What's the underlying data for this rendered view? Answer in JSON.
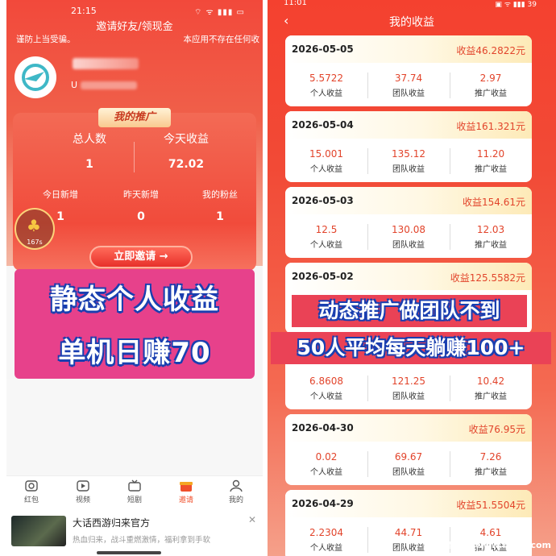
{
  "left": {
    "status_time": "21:15",
    "status_icons": "⌔ ᯤ ▮▮▮ ▭",
    "title": "邀请好友/领现金",
    "notice_left": "谨防上当受骗。",
    "notice_right": "本应用不存在任何收",
    "uid_prefix": "U",
    "promo": {
      "badge": "我的推广",
      "total_people_label": "总人数",
      "total_people_value": "1",
      "today_income_label": "今天收益",
      "today_income_value": "72.02",
      "today_new_label": "今日新增",
      "today_new_value": "1",
      "yesterday_new_label": "昨天新增",
      "yesterday_new_value": "0",
      "fans_label": "我的粉丝",
      "fans_value": "1",
      "invite_button": "立即邀请 →",
      "float_count": "167s"
    },
    "banner_lines": [
      "静态个人收益",
      "单机日赚70"
    ],
    "tabs": [
      {
        "label": "红包",
        "icon": "camera-icon"
      },
      {
        "label": "视频",
        "icon": "play-icon"
      },
      {
        "label": "短剧",
        "icon": "tv-icon"
      },
      {
        "label": "邀请",
        "icon": "gift-icon",
        "active": true
      },
      {
        "label": "我的",
        "icon": "user-icon"
      }
    ],
    "ad": {
      "title": "大话西游归来官方",
      "desc": "热血归来，战斗重燃激情，福利拿到手软",
      "close": "✕"
    },
    "accent_color": "#f04f2b"
  },
  "right": {
    "status_time": "11:01",
    "status_icons": "▣ ᯤ ▮▮▮ 39",
    "back": "‹",
    "title": "我的收益",
    "col_labels": [
      "个人收益",
      "团队收益",
      "推广收益"
    ],
    "cards": [
      {
        "date": "2026-05-05",
        "total": "收益46.2822元",
        "values": [
          "5.5722",
          "37.74",
          "2.97"
        ]
      },
      {
        "date": "2026-05-04",
        "total": "收益161.321元",
        "values": [
          "15.001",
          "135.12",
          "11.20"
        ]
      },
      {
        "date": "2026-05-03",
        "total": "收益154.61元",
        "values": [
          "12.5",
          "130.08",
          "12.03"
        ]
      },
      {
        "date": "2026-05-02",
        "total": "收益125.5582元",
        "values": []
      },
      {
        "date": "",
        "total": "",
        "values": [
          "6.8608",
          "121.25",
          "10.42"
        ]
      },
      {
        "date": "2026-04-30",
        "total": "收益76.95元",
        "values": [
          "0.02",
          "69.67",
          "7.26"
        ]
      },
      {
        "date": "2026-04-29",
        "total": "收益51.5504元",
        "values": [
          "2.2304",
          "44.71",
          "4.61"
        ]
      }
    ],
    "banner_lines": [
      "动态推广做团队不到",
      "50人平均每天躺赚100+"
    ],
    "watermark": "586首码网 www.b586.com",
    "accent_color": "#e2442b"
  }
}
